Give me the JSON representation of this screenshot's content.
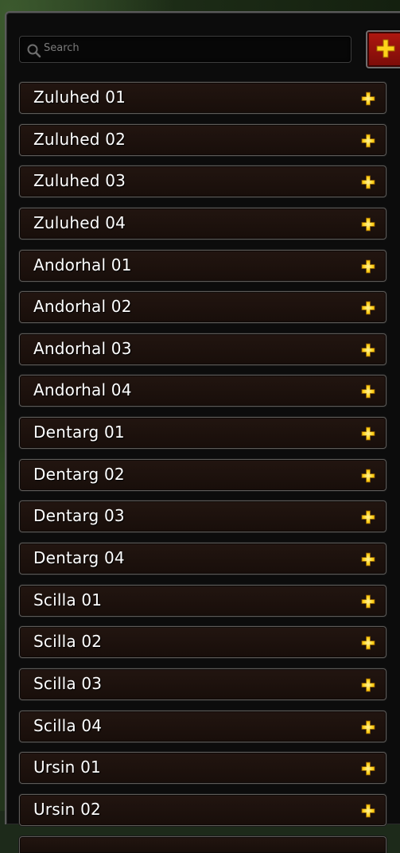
{
  "search": {
    "placeholder": "Search",
    "value": ""
  },
  "toolbar": {
    "add_icon": "plus-icon",
    "accent_color": "#b01810"
  },
  "list": {
    "items": [
      {
        "label": "Zuluhed 01"
      },
      {
        "label": "Zuluhed 02"
      },
      {
        "label": "Zuluhed 03"
      },
      {
        "label": "Zuluhed 04"
      },
      {
        "label": "Andorhal 01"
      },
      {
        "label": "Andorhal 02"
      },
      {
        "label": "Andorhal 03"
      },
      {
        "label": "Andorhal 04"
      },
      {
        "label": "Dentarg 01"
      },
      {
        "label": "Dentarg 02"
      },
      {
        "label": "Dentarg 03"
      },
      {
        "label": "Dentarg 04"
      },
      {
        "label": "Scilla 01"
      },
      {
        "label": "Scilla 02"
      },
      {
        "label": "Scilla 03"
      },
      {
        "label": "Scilla 04"
      },
      {
        "label": "Ursin 01"
      },
      {
        "label": "Ursin 02"
      }
    ],
    "item_icon": "plus-icon",
    "plus_color": "#ffd21a"
  }
}
